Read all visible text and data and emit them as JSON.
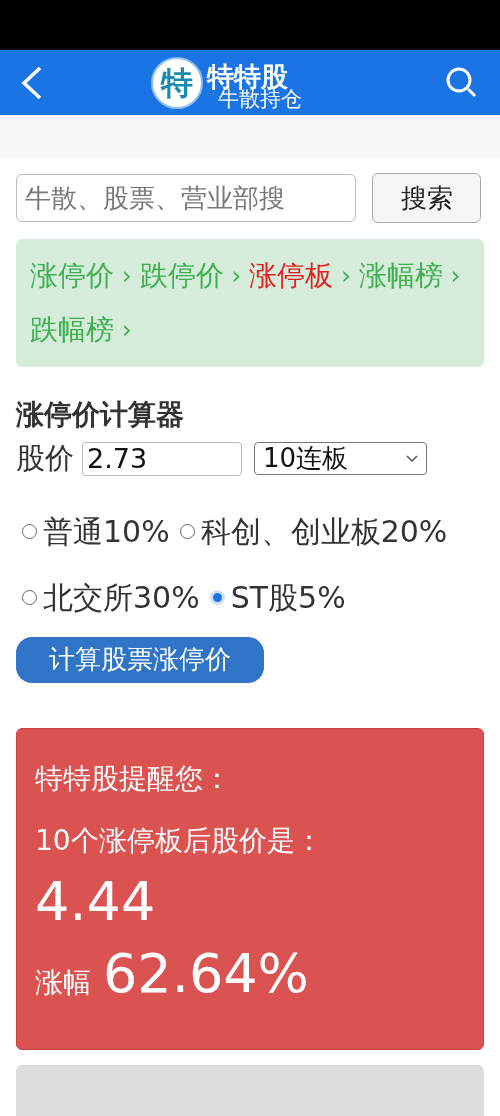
{
  "header": {
    "logo_char": "特",
    "title": "特特股",
    "subtitle": "牛散持仓"
  },
  "search": {
    "placeholder": "牛散、股票、营业部搜",
    "button": "搜索"
  },
  "links": [
    {
      "label": "涨停价",
      "active": false
    },
    {
      "label": "跌停价",
      "active": false
    },
    {
      "label": "涨停板",
      "active": true
    },
    {
      "label": "涨幅榜",
      "active": false
    },
    {
      "label": "跌幅榜",
      "active": false
    }
  ],
  "link_separator": "›",
  "calculator": {
    "title": "涨停价计算器",
    "price_label": "股价",
    "price_value": "2.73",
    "boards_value": "10连板",
    "options": [
      {
        "label": "普通10%",
        "selected": false
      },
      {
        "label": "科创、创业板20%",
        "selected": false
      },
      {
        "label": "北交所30%",
        "selected": false
      },
      {
        "label": "ST股5%",
        "selected": true
      }
    ],
    "button": "计算股票涨停价"
  },
  "result": {
    "heading": "特特股提醒您：",
    "line": "10个涨停板后股价是：",
    "price": "4.44",
    "change_label": "涨幅",
    "change_value": "62.64%"
  }
}
